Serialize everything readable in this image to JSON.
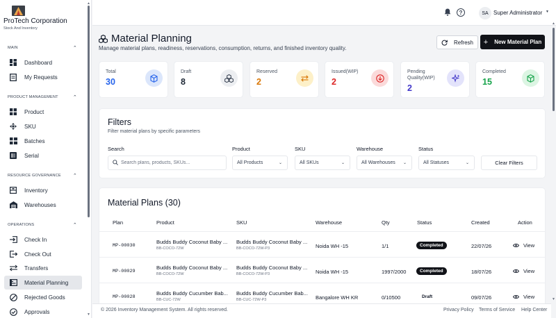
{
  "brand": {
    "name": "ProTech Corporation",
    "subtitle": "Stock And Inventory"
  },
  "sidebar": {
    "sections": [
      {
        "title": "MAIN",
        "items": [
          {
            "label": "Dashboard",
            "icon": "grid-icon"
          },
          {
            "label": "My Requests",
            "icon": "document-icon"
          }
        ]
      },
      {
        "title": "PRODUCT MANAGEMENT",
        "items": [
          {
            "label": "Product",
            "icon": "apps-icon"
          },
          {
            "label": "SKU",
            "icon": "move-icon"
          },
          {
            "label": "Batches",
            "icon": "stack-icon"
          },
          {
            "label": "Serial",
            "icon": "serial-icon"
          }
        ]
      },
      {
        "title": "RESOURCE GOVERNANCE",
        "items": [
          {
            "label": "Inventory",
            "icon": "inventory-icon"
          },
          {
            "label": "Warehouses",
            "icon": "warehouse-icon"
          }
        ]
      },
      {
        "title": "OPERATIONS",
        "items": [
          {
            "label": "Check In",
            "icon": "check-in-icon"
          },
          {
            "label": "Check Out",
            "icon": "check-out-icon"
          },
          {
            "label": "Transfers",
            "icon": "transfer-icon"
          },
          {
            "label": "Material Planning",
            "icon": "planning-icon",
            "active": true
          },
          {
            "label": "Rejected Goods",
            "icon": "rejected-icon"
          },
          {
            "label": "Approvals",
            "icon": "approval-icon"
          }
        ]
      }
    ]
  },
  "topbar": {
    "avatar_initials": "SA",
    "user_name": "Super Administrator"
  },
  "page": {
    "title": "Material Planning",
    "subtitle": "Manage material plans, readiness, reservations, consumption, returns, and finished inventory quality.",
    "refresh_label": "Refresh",
    "new_label": "New Material Plan"
  },
  "stats": [
    {
      "label": "Total",
      "value": "30",
      "color": "#2563eb",
      "icon": "cube-icon",
      "icon_bg": "#dbe6fb"
    },
    {
      "label": "Draft",
      "value": "8",
      "color": "#1f2937",
      "icon": "cubes-icon",
      "icon_bg": "#eceef1"
    },
    {
      "label": "Reserved",
      "value": "2",
      "color": "#d97706",
      "icon": "swap-icon",
      "icon_bg": "#fdf0c8"
    },
    {
      "label": "Issued(WIP)",
      "value": "2",
      "color": "#dc2626",
      "icon": "arrow-down-circle-icon",
      "icon_bg": "#fbdada"
    },
    {
      "label": "Pending Quality(WIP)",
      "value": "2",
      "color": "#4338ca",
      "icon": "sparkle-icon",
      "icon_bg": "#e3e3fb"
    },
    {
      "label": "Completed",
      "value": "15",
      "color": "#16a34a",
      "icon": "box-check-icon",
      "icon_bg": "#dcf5e3"
    }
  ],
  "filters": {
    "title": "Filters",
    "subtitle": "Filter material plans by specific parameters",
    "search_label": "Search",
    "search_placeholder": "Search plans, products, SKUs...",
    "product_label": "Product",
    "product_value": "All Products",
    "sku_label": "SKU",
    "sku_value": "All SKUs",
    "warehouse_label": "Warehouse",
    "warehouse_value": "All Warehouses",
    "status_label": "Status",
    "status_value": "All Statuses",
    "clear_label": "Clear Filters"
  },
  "plans": {
    "title": "Material Plans (30)",
    "columns": [
      "Plan",
      "Product",
      "SKU",
      "Warehouse",
      "Qty",
      "Status",
      "Created",
      "Action"
    ],
    "rows": [
      {
        "plan": "MP-00030",
        "product": "Budds Buddy Coconut Baby ...",
        "product_sku": "BB-COCO-72W",
        "sku": "Budds Buddy Coconut Baby ...",
        "sku_code": "BB-COCO-72W-P3",
        "warehouse": "Noida WH -15",
        "qty": "1/1",
        "status": "Completed",
        "created": "22/07/26",
        "action": "View"
      },
      {
        "plan": "MP-00029",
        "product": "Budds Buddy Coconut Baby ...",
        "product_sku": "BB-COCO-72W",
        "sku": "Budds Buddy Coconut Baby ...",
        "sku_code": "BB-COCO-72W-P3",
        "warehouse": "Noida WH -15",
        "qty": "1997/2000",
        "status": "Completed",
        "created": "18/07/26",
        "action": "View"
      },
      {
        "plan": "MP-00028",
        "product": "Budds Buddy Cucumber Bab...",
        "product_sku": "BB-CUC-72W",
        "sku": "Budds Buddy Cucumber Bab...",
        "sku_code": "BB-CUC-72W-P3",
        "warehouse": "Bangalore WH KR",
        "qty": "0/10500",
        "status": "Draft",
        "created": "09/07/26",
        "action": "View"
      }
    ]
  },
  "footer": {
    "copyright": "© 2026 Inventory Management System. All rights reserved.",
    "links": [
      "Privacy Policy",
      "Terms of Service",
      "Help Center"
    ]
  }
}
